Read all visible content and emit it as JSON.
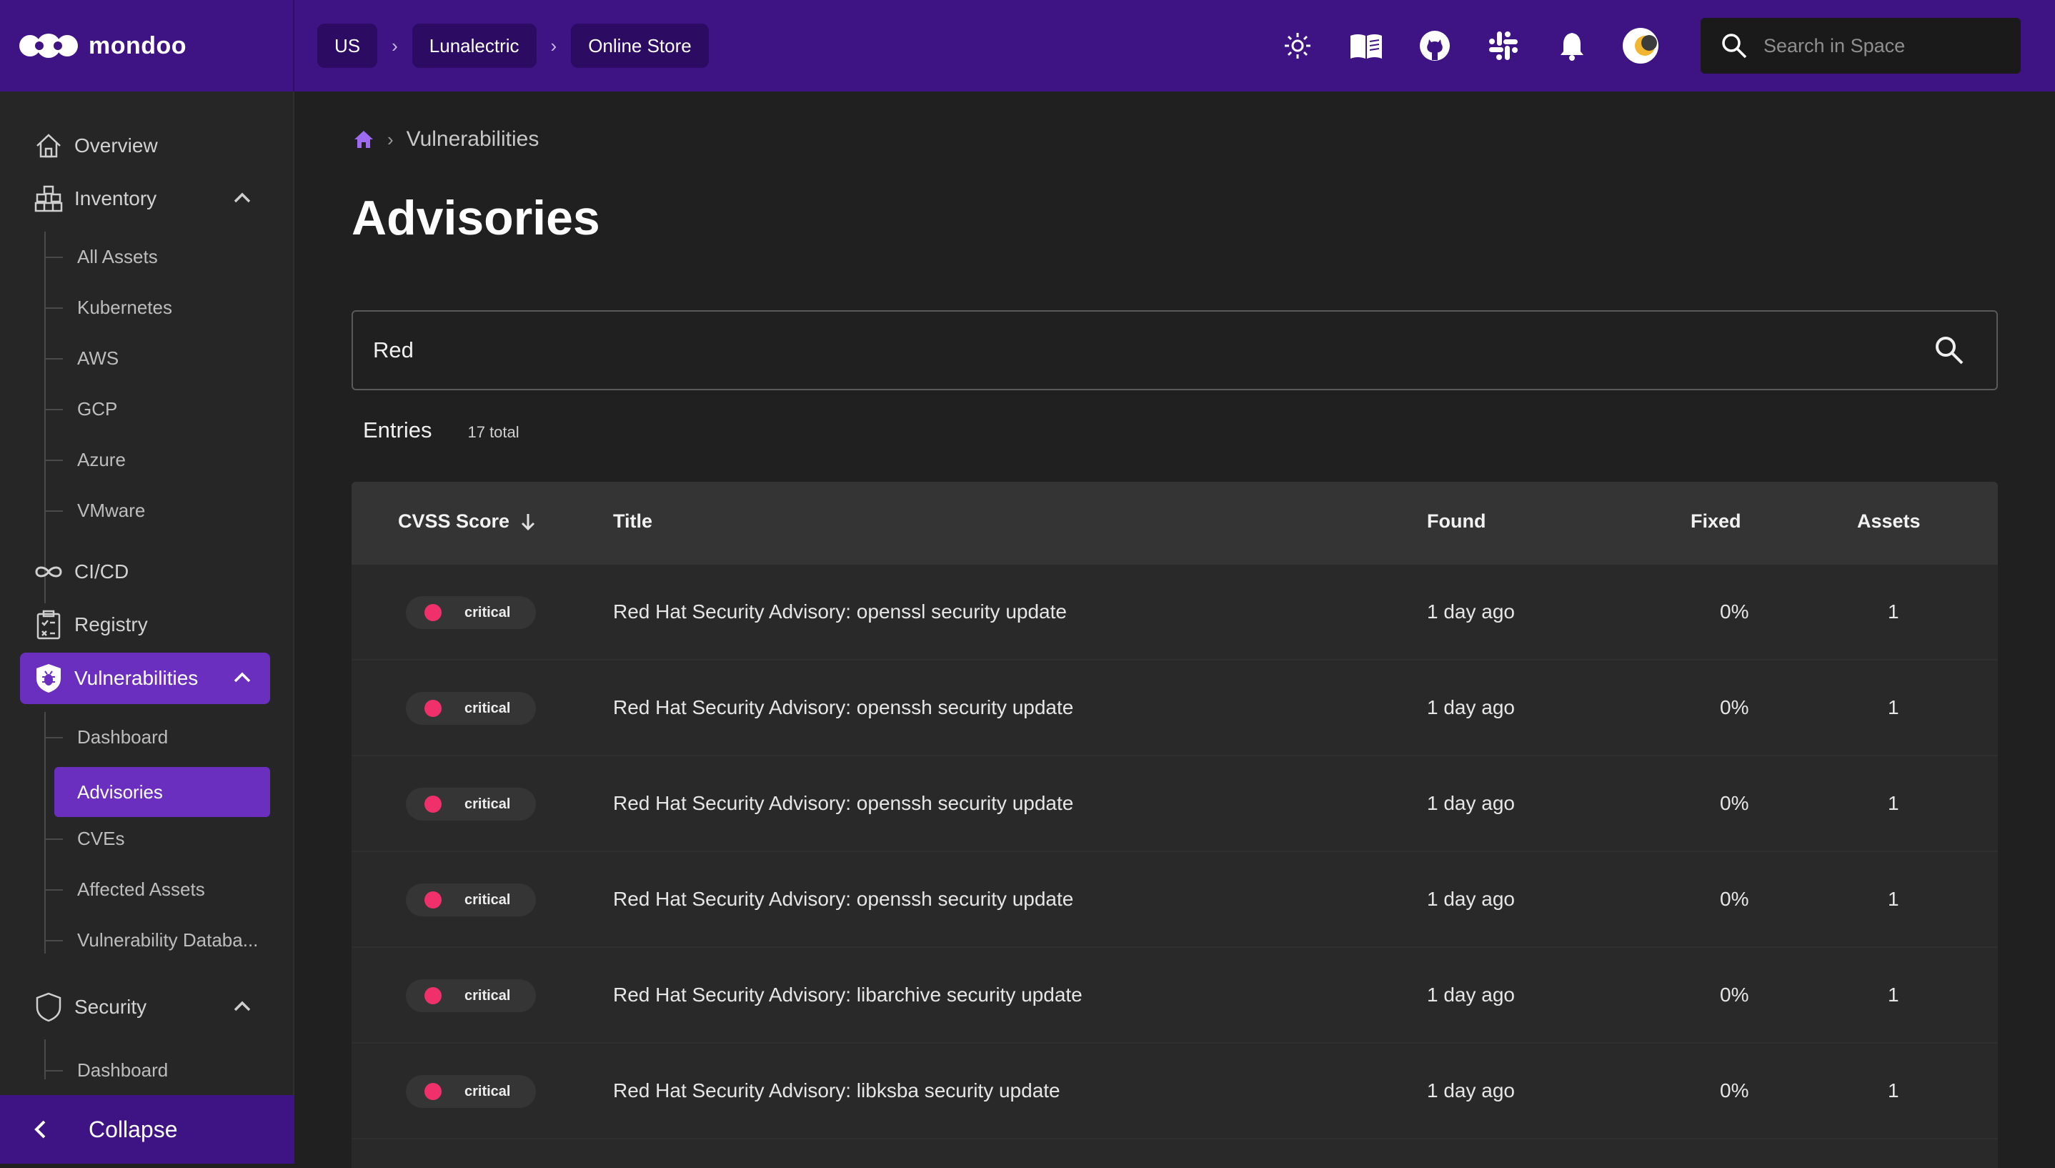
{
  "app": {
    "name": "mondoo"
  },
  "header": {
    "breadcrumbs": [
      "US",
      "Lunalectric",
      "Online Store"
    ],
    "search_placeholder": "Search in Space",
    "icons": [
      "theme-sun-icon",
      "docs-book-icon",
      "github-icon",
      "slack-icon",
      "bell-icon",
      "avatar"
    ]
  },
  "sidebar": {
    "items": [
      {
        "label": "Overview",
        "icon": "home-icon"
      },
      {
        "label": "Inventory",
        "icon": "inventory-icon",
        "expanded": true,
        "children": [
          "All Assets",
          "Kubernetes",
          "AWS",
          "GCP",
          "Azure",
          "VMware"
        ]
      },
      {
        "label": "CI/CD",
        "icon": "infinity-icon"
      },
      {
        "label": "Registry",
        "icon": "registry-icon"
      },
      {
        "label": "Vulnerabilities",
        "icon": "shield-bug-icon",
        "expanded": true,
        "active": true,
        "children": [
          "Dashboard",
          "Advisories",
          "CVEs",
          "Affected Assets",
          "Vulnerability Databa..."
        ]
      },
      {
        "label": "Security",
        "icon": "shield-icon",
        "expanded": true,
        "children": [
          "Dashboard"
        ]
      }
    ],
    "active_child": "Advisories",
    "collapse_label": "Collapse"
  },
  "main": {
    "breadcrumb": "Vulnerabilities",
    "title": "Advisories",
    "filter_value": "Red",
    "entries_label": "Entries",
    "entries_count": "17 total",
    "table": {
      "columns": [
        "CVSS Score",
        "Title",
        "Found",
        "Fixed",
        "Assets"
      ],
      "rows": [
        {
          "severity": "critical",
          "title": "Red Hat Security Advisory: openssl security update",
          "found": "1 day ago",
          "fixed": "0%",
          "assets": "1"
        },
        {
          "severity": "critical",
          "title": "Red Hat Security Advisory: openssh security update",
          "found": "1 day ago",
          "fixed": "0%",
          "assets": "1"
        },
        {
          "severity": "critical",
          "title": "Red Hat Security Advisory: openssh security update",
          "found": "1 day ago",
          "fixed": "0%",
          "assets": "1"
        },
        {
          "severity": "critical",
          "title": "Red Hat Security Advisory: openssh security update",
          "found": "1 day ago",
          "fixed": "0%",
          "assets": "1"
        },
        {
          "severity": "critical",
          "title": "Red Hat Security Advisory: libarchive security update",
          "found": "1 day ago",
          "fixed": "0%",
          "assets": "1"
        },
        {
          "severity": "critical",
          "title": "Red Hat Security Advisory: libksba security update",
          "found": "1 day ago",
          "fixed": "0%",
          "assets": "1"
        }
      ]
    }
  },
  "colors": {
    "brand_purple": "#3e1484",
    "active_purple": "#6b2fc0",
    "critical": "#f0306a"
  }
}
